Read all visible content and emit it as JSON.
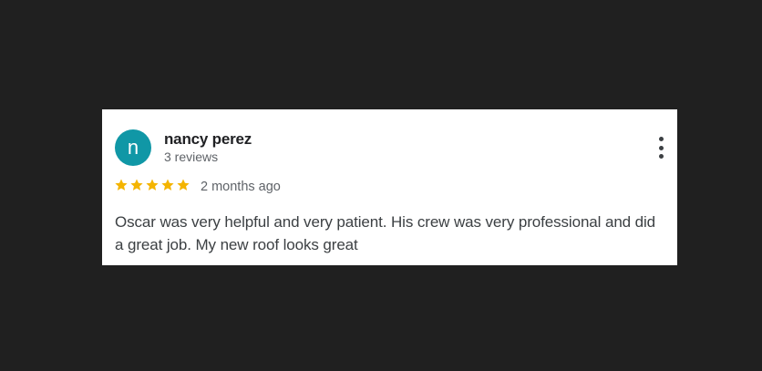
{
  "review": {
    "avatar_initial": "n",
    "avatar_color": "#1097a6",
    "author_name": "nancy perez",
    "review_count": "3 reviews",
    "rating": 5,
    "rating_max": 5,
    "star_color": "#f4b400",
    "relative_time": "2 months ago",
    "text": "Oscar was very helpful and very patient. His crew was very professional and did a great job. My new roof looks great",
    "menu_icon": "more-vert-icon"
  }
}
